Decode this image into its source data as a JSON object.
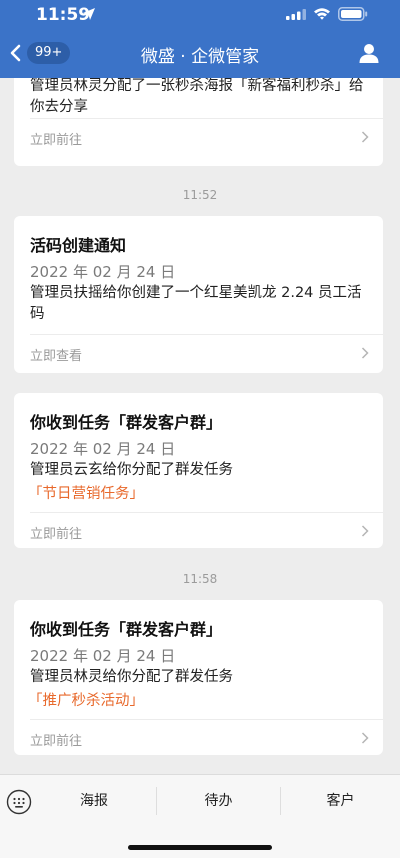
{
  "status": {
    "time": "11:59"
  },
  "nav": {
    "back_badge": "99+",
    "title": "微盛 · 企微管家"
  },
  "feed": {
    "card0": {
      "body": "管理员林灵分配了一张秒杀海报「新客福利秒杀」给你去分享",
      "link": "立即前往"
    },
    "ts1": "11:52",
    "card1": {
      "heading": "活码创建通知",
      "date": "2022 年 02 月 24 日",
      "body": "管理员扶摇给你创建了一个红星美凯龙 2.24 员工活码",
      "link": "立即查看"
    },
    "card2": {
      "heading": "你收到任务「群发客户群」",
      "date": "2022 年 02 月 24 日",
      "body": "管理员云玄给你分配了群发任务",
      "task": "「节日营销任务」",
      "link": "立即前往"
    },
    "ts2": "11:58",
    "card3": {
      "heading": "你收到任务「群发客户群」",
      "date": "2022 年 02 月 24 日",
      "body": "管理员林灵给你分配了群发任务",
      "task": "「推广秒杀活动」",
      "link": "立即前往"
    }
  },
  "tabbar": {
    "tabs": [
      "海报",
      "待办",
      "客户"
    ]
  },
  "colors": {
    "nav_blue": "#3b73c8",
    "task_orange": "#e8692c"
  },
  "icons": [
    "location-arrow-icon",
    "signal-icon",
    "wifi-icon",
    "battery-icon",
    "back-chevron-icon",
    "user-icon",
    "chevron-right-icon",
    "keyboard-icon"
  ]
}
